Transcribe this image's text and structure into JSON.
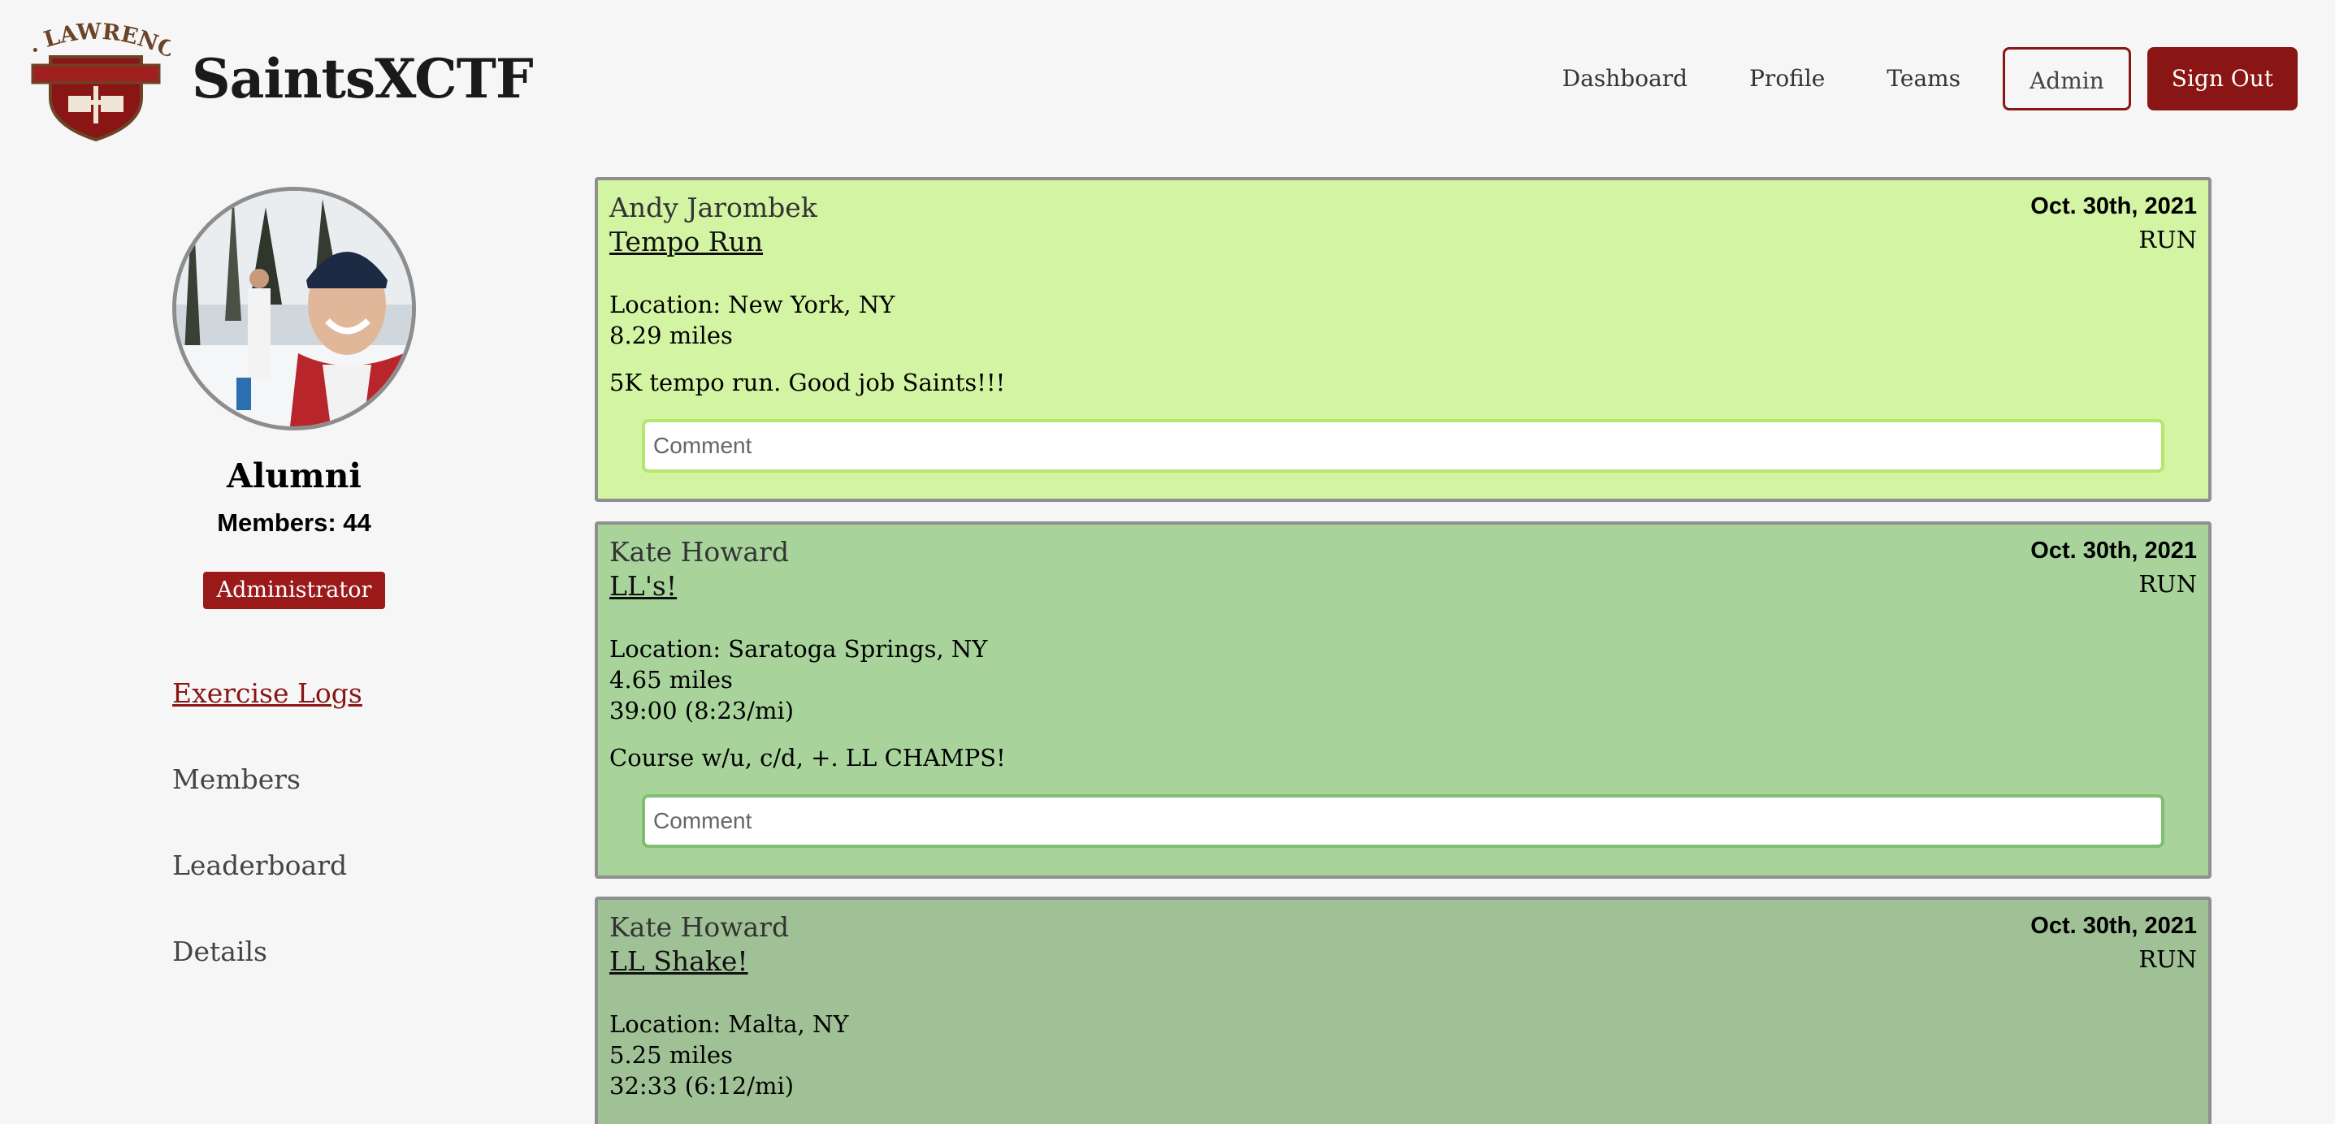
{
  "header": {
    "logo_text": "ST. LAWRENCE",
    "app_title": "SaintsXCTF",
    "nav": {
      "dashboard": "Dashboard",
      "profile": "Profile",
      "teams": "Teams",
      "admin": "Admin",
      "sign_out": "Sign Out"
    }
  },
  "sidebar": {
    "group_name": "Alumni",
    "members_count": "Members: 44",
    "role": "Administrator",
    "nav": [
      "Exercise Logs",
      "Members",
      "Leaderboard",
      "Details"
    ]
  },
  "logs": [
    {
      "user": "Andy Jarombek",
      "title": "Tempo Run",
      "date": "Oct. 30th, 2021",
      "type": "RUN",
      "location": "Location: New York, NY",
      "distance": "8.29 miles",
      "description": "5K tempo run. Good job Saints!!!",
      "comment_placeholder": "Comment"
    },
    {
      "user": "Kate Howard",
      "title": "LL's!",
      "date": "Oct. 30th, 2021",
      "type": "RUN",
      "location": "Location: Saratoga Springs, NY",
      "distance": "4.65 miles",
      "time": "39:00 (8:23/mi)",
      "description": "Course w/u, c/d, +. LL CHAMPS!",
      "comment_placeholder": "Comment"
    },
    {
      "user": "Kate Howard",
      "title": "LL Shake!",
      "date": "Oct. 30th, 2021",
      "type": "RUN",
      "location": "Location: Malta, NY",
      "distance": "5.25 miles",
      "time": "32:33 (6:12/mi)"
    }
  ],
  "colors": {
    "brand": "#8a1515",
    "log_light": "#d3f4a3",
    "log_medium": "#a8d49c",
    "log_dark": "#a0c196"
  }
}
